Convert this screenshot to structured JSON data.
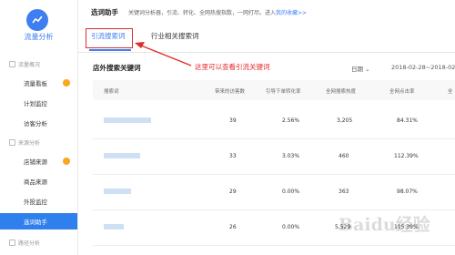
{
  "sidebar": {
    "brand": "流量分析",
    "sections": [
      {
        "label": "流量概况",
        "items": [
          "流量看板",
          "计划监控",
          "访客分析"
        ]
      },
      {
        "label": "来源分析",
        "items": [
          "店铺来源",
          "商品来源",
          "外投监控",
          "选词助手"
        ]
      },
      {
        "label": "路径分析",
        "items": []
      }
    ],
    "active_item": "选词助手"
  },
  "header": {
    "title": "选词助手",
    "description": "关键词分析器，引流、转化、全网热搜指数，一网打尽。进入",
    "link_text": "我的收藏>>"
  },
  "tabs": [
    "引流搜索词",
    "行业相关搜索词"
  ],
  "annotation": "这里可以查看引流关键词",
  "table": {
    "title": "店外搜索关键词",
    "date_label": "日期",
    "date_range": "2018-02-28~2018-02-",
    "columns": [
      "搜索词",
      "带来的访客数",
      "引导下单转化率",
      "全网搜索热度",
      "全网点击率",
      "全"
    ],
    "rows": [
      {
        "visitors": "39",
        "conv": "2.56%",
        "heat": "3,205",
        "ctr": "84.31%"
      },
      {
        "visitors": "33",
        "conv": "3.03%",
        "heat": "460",
        "ctr": "112.39%"
      },
      {
        "visitors": "29",
        "conv": "0.00%",
        "heat": "363",
        "ctr": "98.07%"
      },
      {
        "visitors": "26",
        "conv": "0.00%",
        "heat": "5,529",
        "ctr": "115.39%"
      }
    ]
  },
  "watermark": "Baidu经验",
  "colors": {
    "accent": "#3d7ff0",
    "annotation": "#e02b2b",
    "badge": "#f7a81b"
  }
}
